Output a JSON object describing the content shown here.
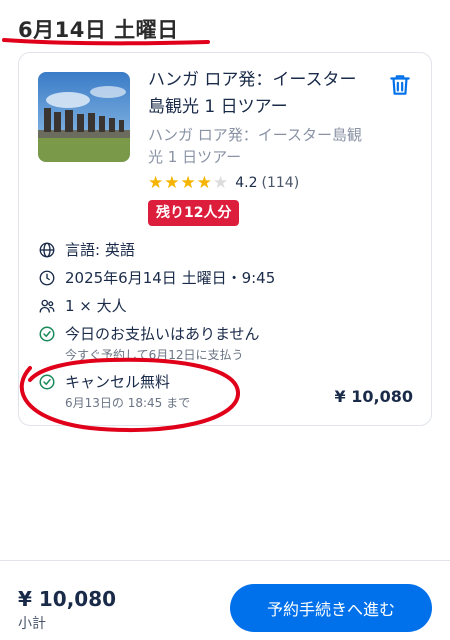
{
  "header": {
    "date": "6月14日 土曜日"
  },
  "card": {
    "title": "ハンガ ロア発：イースター島観光 1 日ツアー",
    "subtitle": "ハンガ ロア発：イースター島観光 1 日ツアー",
    "rating": {
      "stars": 4,
      "max": 5,
      "value": "4.2",
      "count": "(114)"
    },
    "badge": "残り12人分",
    "language": "言語: 英語",
    "datetime": "2025年6月14日 土曜日・9:45",
    "participants": "1 × 大人",
    "no_payment": "今日のお支払いはありません",
    "pay_later_note": "今すぐ予約して6月12日に支払う",
    "cancellation": "キャンセル無料",
    "cancellation_deadline": "6月13日の 18:45 まで",
    "price": "¥ 10,080"
  },
  "footer": {
    "total": "¥ 10,080",
    "total_label": "小計",
    "cta_label": "予約手続きへ進む"
  },
  "colors": {
    "primary": "#0071eb",
    "badge": "#dc1e3c",
    "star": "#f5b400",
    "check": "#1a8a5a",
    "marker": "#e0001a"
  },
  "icons": [
    "trash-icon",
    "globe-icon",
    "clock-icon",
    "people-icon",
    "check-circle-icon",
    "star-icon"
  ]
}
